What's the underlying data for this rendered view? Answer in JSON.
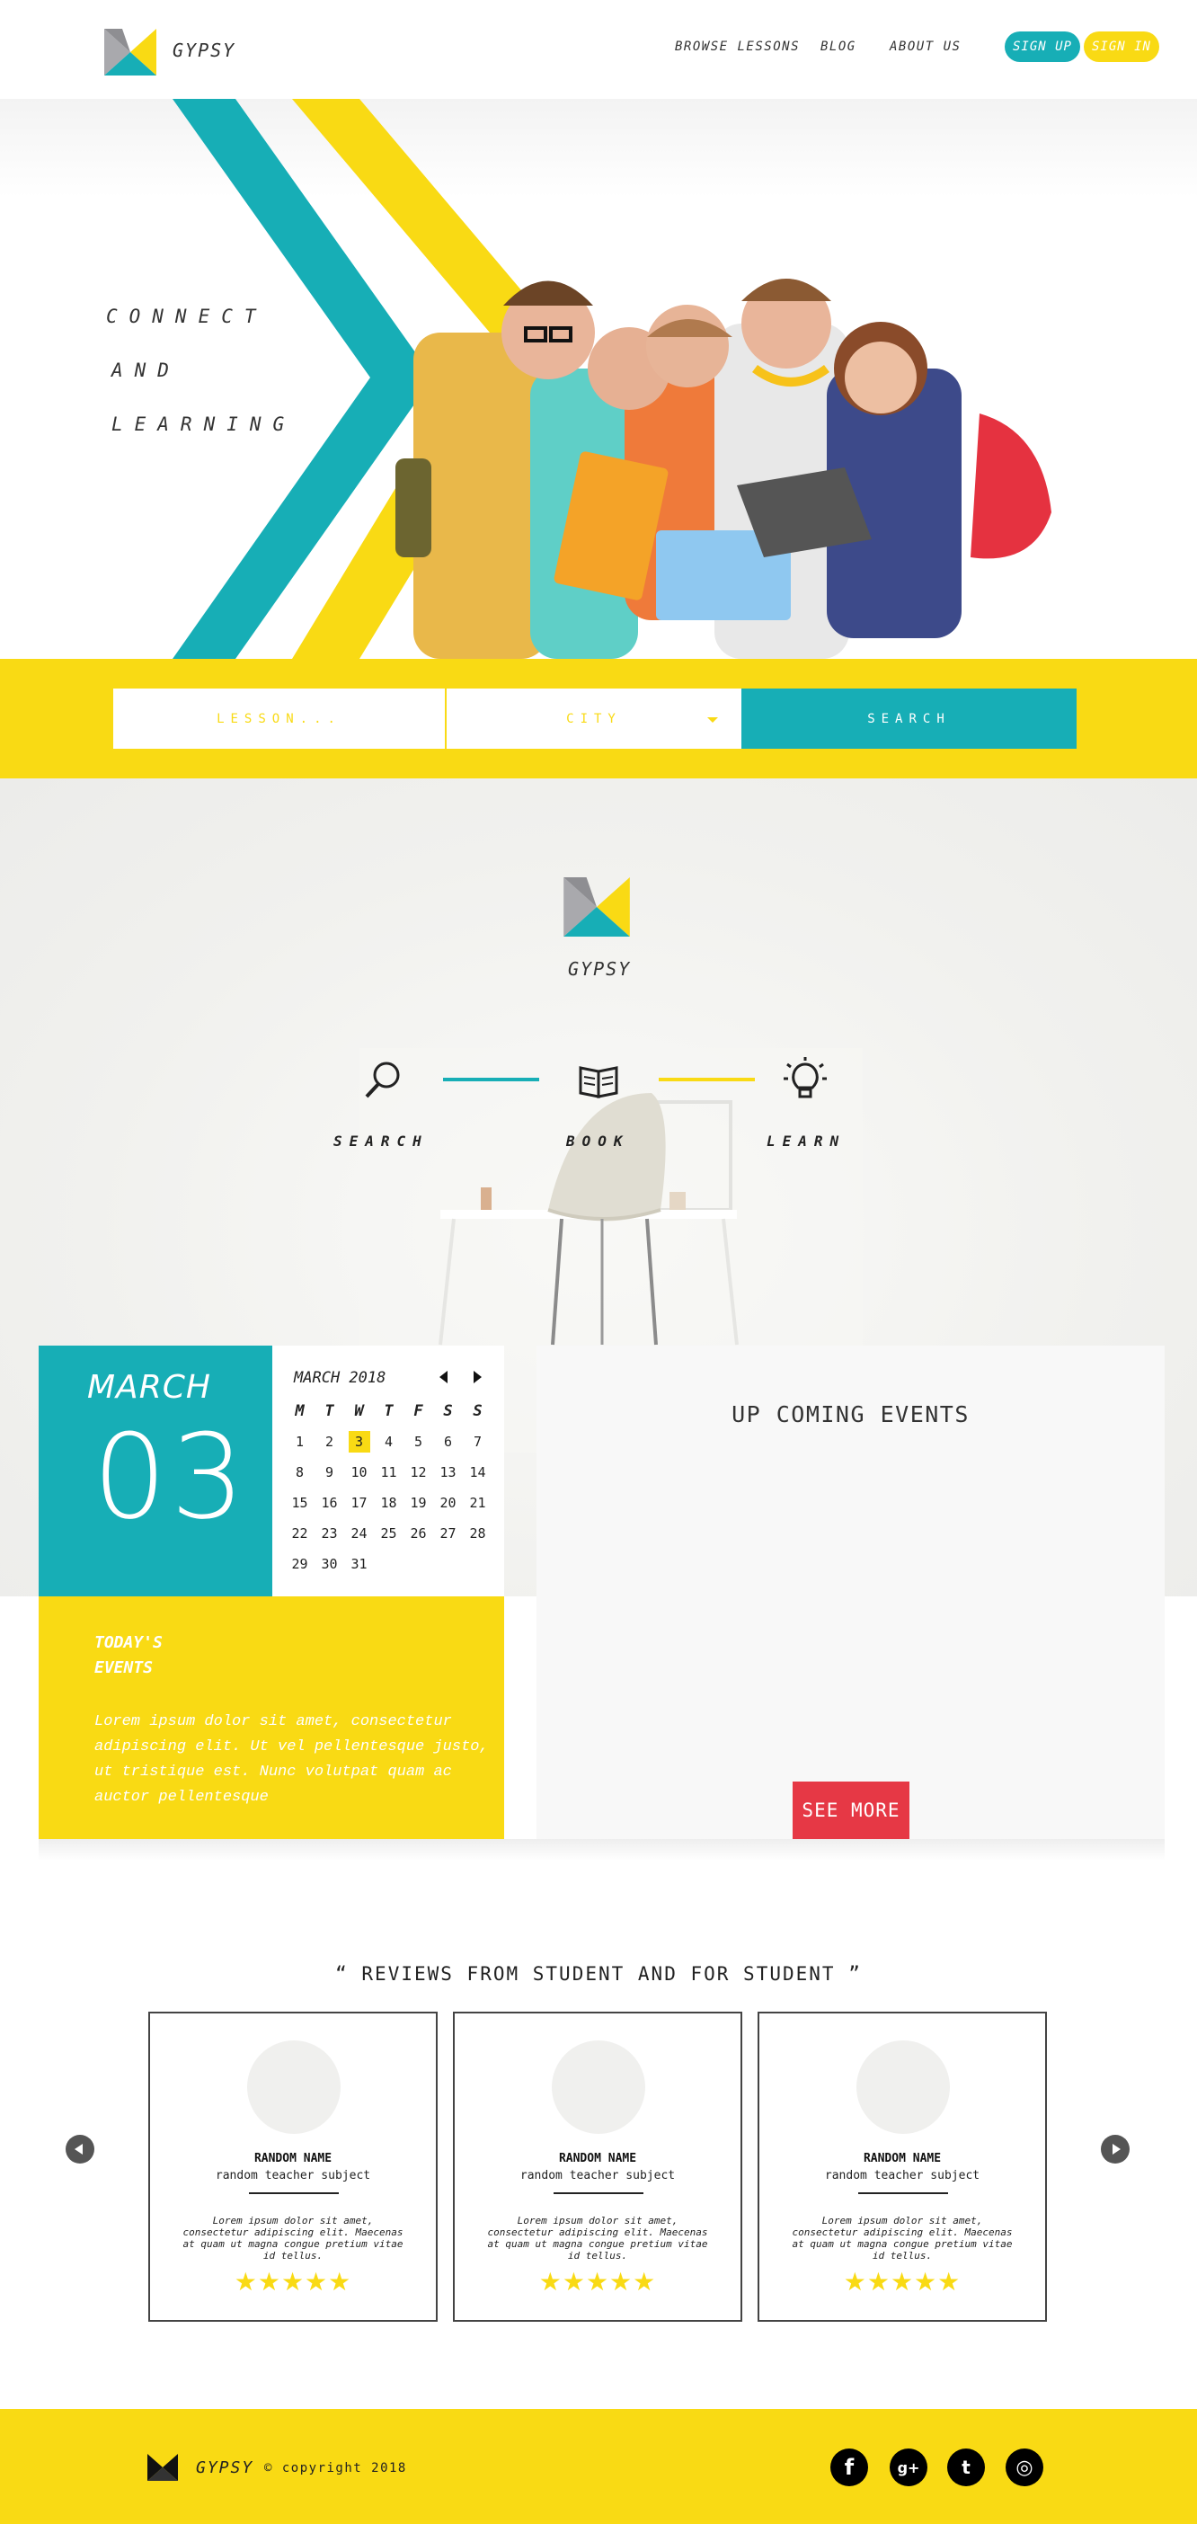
{
  "brand": "GYPSY",
  "colors": {
    "teal": "#17aeb6",
    "yellow": "#f9da14",
    "red": "#e63845",
    "gray": "#a9a9ad"
  },
  "header": {
    "nav": [
      "BROWSE LESSONS",
      "BLOG",
      "ABOUT US"
    ],
    "sign_up": "SIGN UP",
    "sign_in": "SIGN IN"
  },
  "hero": {
    "lines": [
      "CONNECT",
      "AND",
      "LEARNING"
    ]
  },
  "search": {
    "lesson_placeholder": "LESSON...",
    "city_placeholder": "CITY",
    "button": "SEARCH"
  },
  "steps": [
    {
      "label": "SEARCH",
      "icon": "magnifier-icon"
    },
    {
      "label": "BOOK",
      "icon": "open-book-icon"
    },
    {
      "label": "LEARN",
      "icon": "lightbulb-icon"
    }
  ],
  "events": {
    "month": "MARCH",
    "day": "03",
    "calendar_title": "MARCH 2018",
    "weekdays": [
      "M",
      "T",
      "W",
      "T",
      "F",
      "S",
      "S"
    ],
    "weeks": [
      [
        "1",
        "2",
        "3",
        "4",
        "5",
        "6",
        "7"
      ],
      [
        "8",
        "9",
        "10",
        "11",
        "12",
        "13",
        "14"
      ],
      [
        "15",
        "16",
        "17",
        "18",
        "19",
        "20",
        "21"
      ],
      [
        "22",
        "23",
        "24",
        "25",
        "26",
        "27",
        "28"
      ],
      [
        "29",
        "30",
        "31",
        "",
        "",
        "",
        ""
      ]
    ],
    "selected_day": "3",
    "today_title": "TODAY'S EVENTS",
    "today_text": "Lorem ipsum dolor sit amet, consectetur adipiscing elit. Ut vel pellentesque justo, ut tristique est. Nunc volutpat quam ac auctor pellentesque",
    "upcoming_title": "UP COMING EVENTS",
    "see_more": "SEE MORE"
  },
  "reviews": {
    "title": "“ REVIEWS FROM STUDENT AND FOR STUDENT ”",
    "cards": [
      {
        "name": "RANDOM NAME",
        "subject": "random teacher subject",
        "quote": "Lorem ipsum dolor sit amet, consectetur adipiscing elit. Maecenas at quam ut magna congue pretium vitae id tellus.",
        "stars": "★★★★★",
        "rating": 5
      },
      {
        "name": "RANDOM NAME",
        "subject": "random teacher subject",
        "quote": "Lorem ipsum dolor sit amet, consectetur adipiscing elit. Maecenas at quam ut magna congue pretium vitae id tellus.",
        "stars": "★★★★★",
        "rating": 5
      },
      {
        "name": "RANDOM NAME",
        "subject": "random teacher subject",
        "quote": "Lorem ipsum dolor sit amet, consectetur adipiscing elit. Maecenas at quam ut magna congue pretium vitae id tellus.",
        "stars": "★★★★★",
        "rating": 5
      }
    ]
  },
  "footer": {
    "brand": "GYPSY",
    "copyright": "© copyright 2018",
    "social": [
      {
        "icon": "facebook-icon",
        "glyph": "f"
      },
      {
        "icon": "google-plus-icon",
        "glyph": "g+"
      },
      {
        "icon": "twitter-icon",
        "glyph": "t"
      },
      {
        "icon": "instagram-icon",
        "glyph": "◎"
      }
    ]
  }
}
